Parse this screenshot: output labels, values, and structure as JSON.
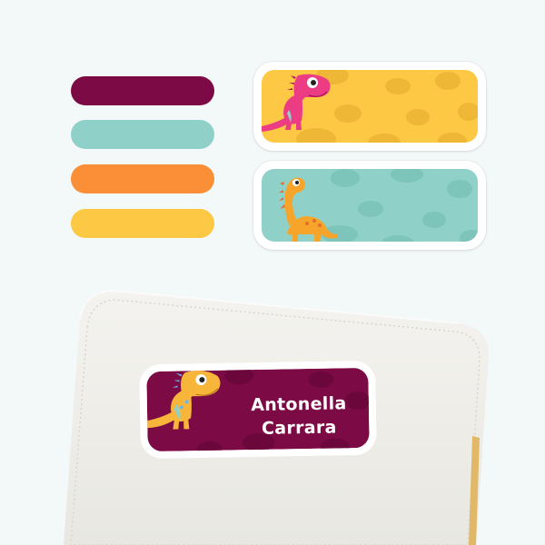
{
  "palette": {
    "swatches": [
      {
        "name": "plum",
        "color": "#7c0a45"
      },
      {
        "name": "teal",
        "color": "#8fd1c8"
      },
      {
        "name": "orange",
        "color": "#fb8f37"
      },
      {
        "name": "yellow",
        "color": "#fdc843"
      }
    ]
  },
  "label_designs": [
    {
      "name": "yellow-trex-label",
      "background": "#fdc843",
      "dino_color": "#ec3c84",
      "icon": "trex-icon"
    },
    {
      "name": "teal-brontosaurus-label",
      "background": "#8fd1c8",
      "dino_color": "#f7a52a",
      "icon": "brontosaurus-icon"
    }
  ],
  "name_label": {
    "first_name": "Antonella",
    "last_name": "Carrara",
    "background": "#7c0a45",
    "dino_color": "#f7b63a",
    "icon": "trex-icon"
  },
  "notebook": {
    "color": "#f0efea"
  }
}
